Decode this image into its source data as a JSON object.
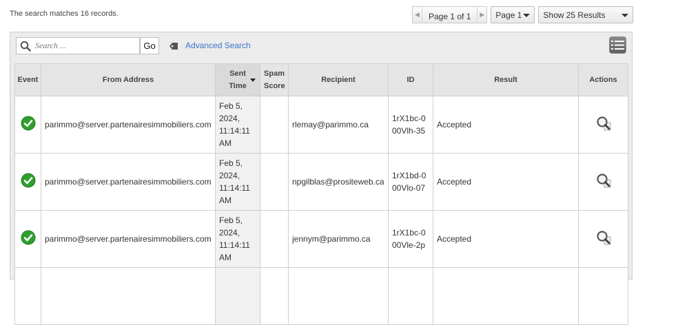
{
  "summary": "The search matches 16 records.",
  "pagination": {
    "page_label": "Page 1 of 1",
    "page_select": "Page 1",
    "results_select": "Show 25 Results"
  },
  "toolbar": {
    "search_placeholder": "Search ...",
    "go_label": "Go",
    "advanced_search": "Advanced Search"
  },
  "table": {
    "headers": {
      "event": "Event",
      "from": "From Address",
      "sent": "Sent Time",
      "spam": "Spam Score",
      "recipient": "Recipient",
      "id": "ID",
      "result": "Result",
      "actions": "Actions"
    },
    "rows": [
      {
        "from": "parimmo@server.partenairesimmobiliers.com",
        "sent": "Feb 5, 2024, 11:14:11 AM",
        "spam": "",
        "recipient": "rlemay@parimmo.ca",
        "id": "1rX1bc-000Vlh-35",
        "result": "Accepted"
      },
      {
        "from": "parimmo@server.partenairesimmobiliers.com",
        "sent": "Feb 5, 2024, 11:14:11 AM",
        "spam": "",
        "recipient": "npgilblas@prositeweb.ca",
        "id": "1rX1bd-000Vlo-07",
        "result": "Accepted"
      },
      {
        "from": "parimmo@server.partenairesimmobiliers.com",
        "sent": "Feb 5, 2024, 11:14:11 AM",
        "spam": "",
        "recipient": "jennym@parimmo.ca",
        "id": "1rX1bc-000Vle-2p",
        "result": "Accepted"
      }
    ]
  },
  "icons": {
    "event": "check-circle-icon",
    "action": "magnifier-icon"
  },
  "colors": {
    "accepted_green": "#2e9e2e",
    "link_blue": "#3a73c9"
  }
}
